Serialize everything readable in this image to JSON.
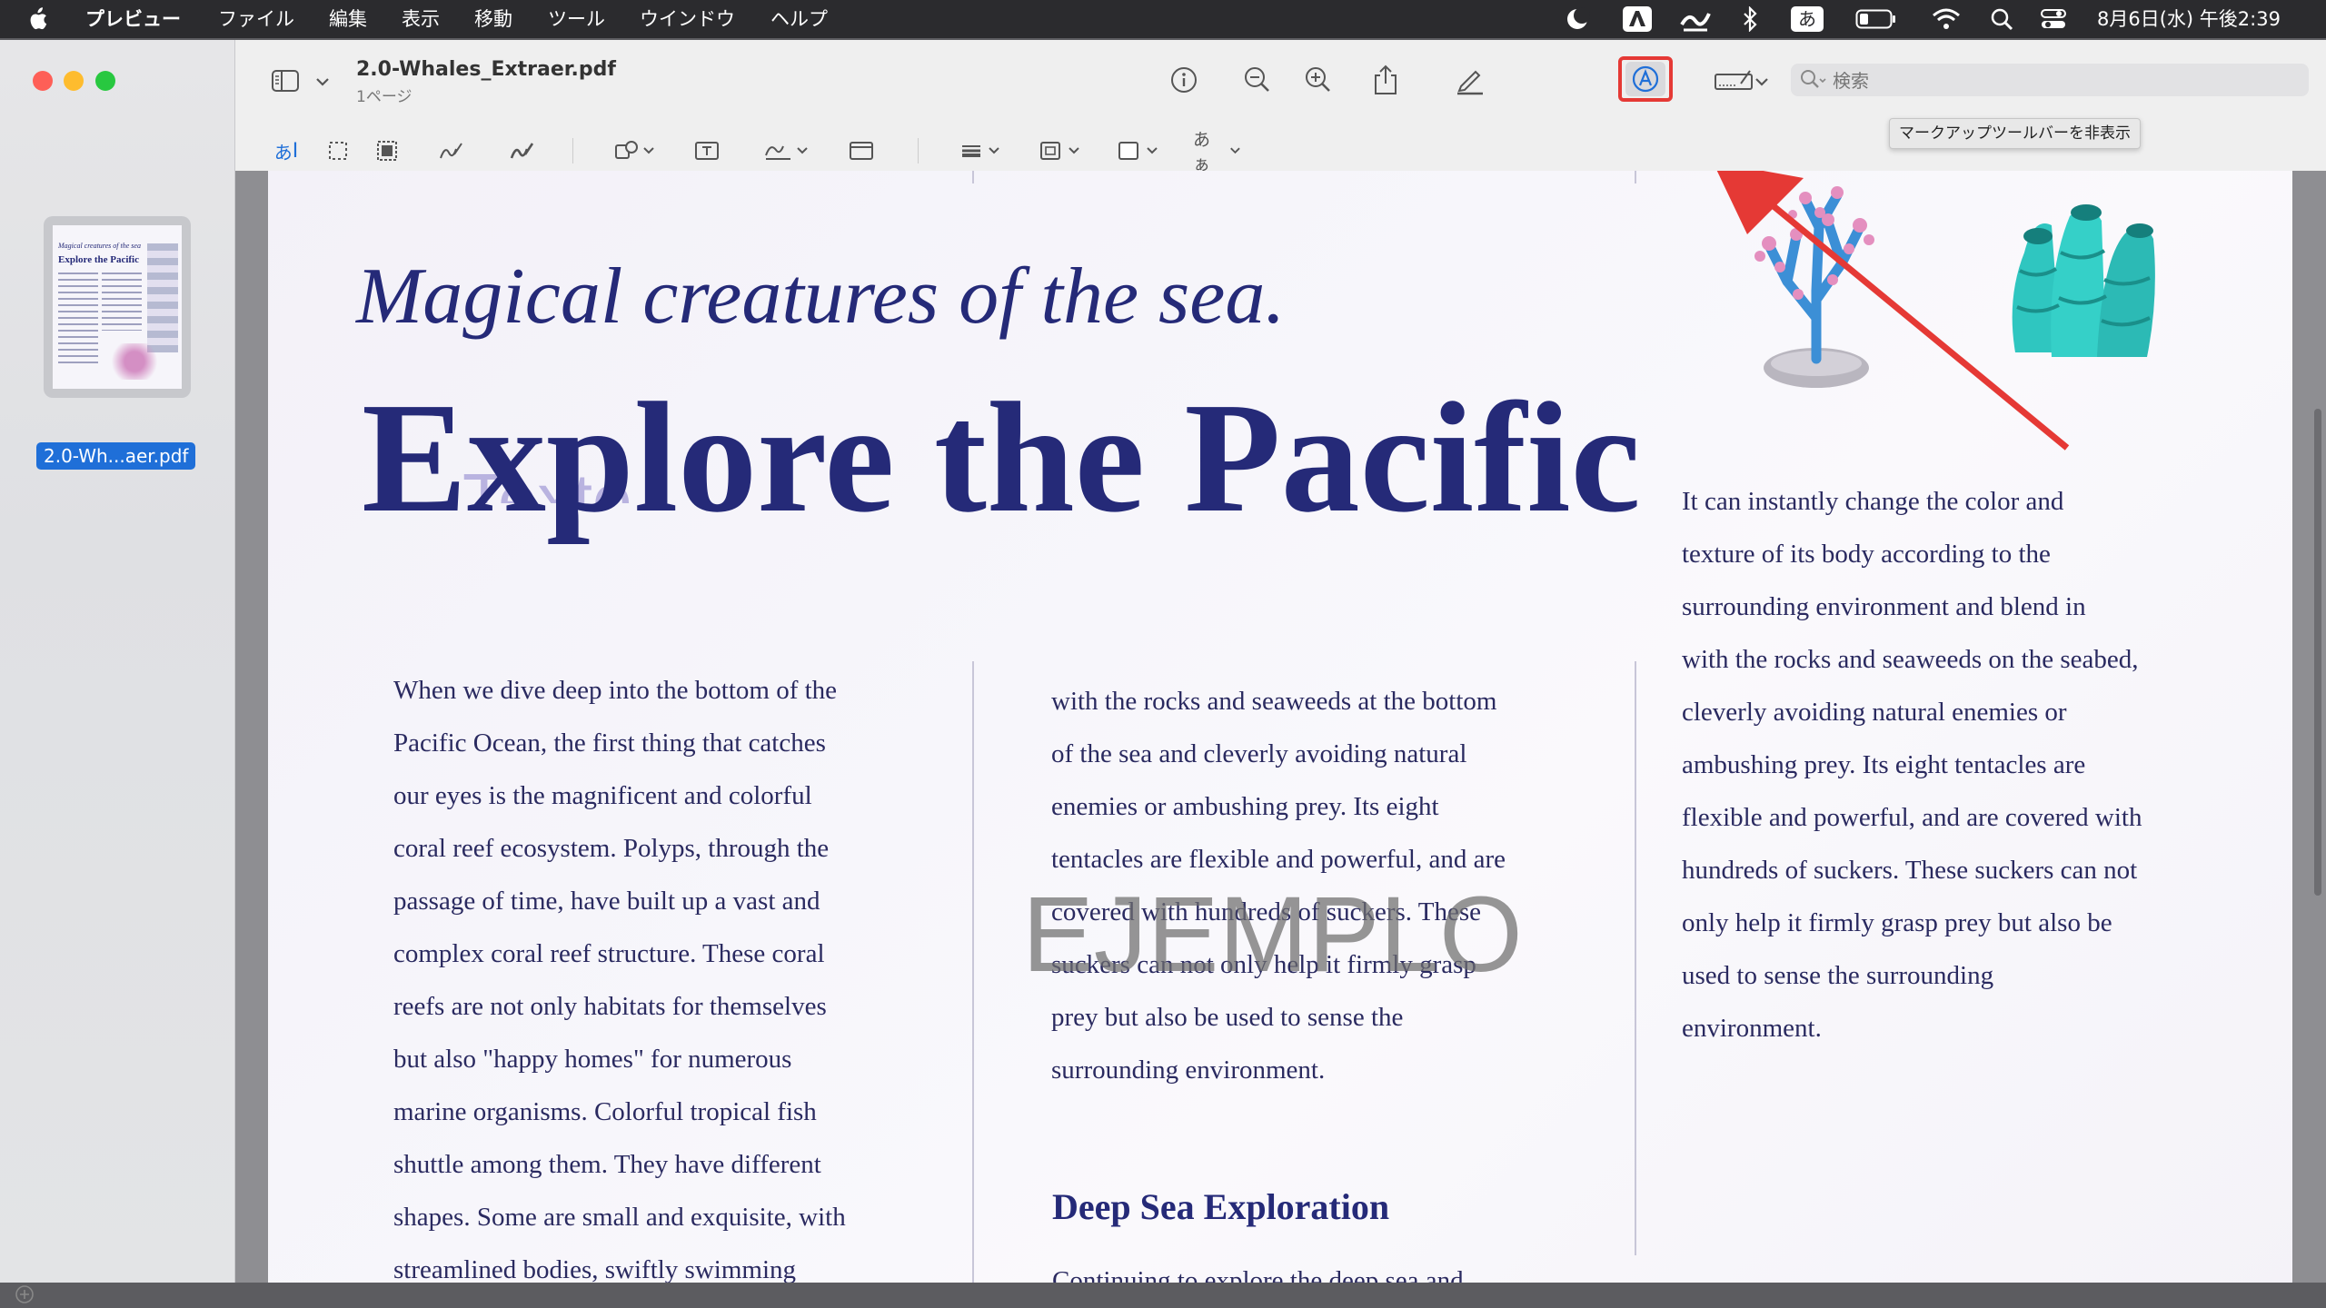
{
  "menubar": {
    "items": [
      "プレビュー",
      "ファイル",
      "編集",
      "表示",
      "移動",
      "ツール",
      "ウインドウ",
      "ヘルプ"
    ],
    "input_source": "あ",
    "datetime": "8月6日(水) 午後2:39"
  },
  "window": {
    "filename": "2.0-Whales_Extraer.pdf",
    "pages": "1ページ",
    "search_placeholder": "検索",
    "tooltip": "マークアップツールバーを非表示"
  },
  "sidebar": {
    "thumbnail_label": "2.0-Wh...aer.pdf",
    "thumb_title_small": "Magical creatures of the sea",
    "thumb_title": "Explore the Pacific"
  },
  "markup": {
    "text_tool": "あ",
    "font_tool": "あぁ"
  },
  "document": {
    "subtitle": "Magical creatures of the sea.",
    "title": "Explore the Pacific",
    "ghost_label": "Texto",
    "watermark": "EJEMPLO",
    "col1_lines": [
      "When we dive deep into the bottom of the",
      "Pacific Ocean, the first thing that catches",
      "our eyes is the magnificent and colorful",
      "coral reef ecosystem. Polyps, through the",
      "passage of time, have built up a vast and",
      "complex coral reef structure. These coral",
      "reefs are not only habitats for themselves",
      "but also \"happy homes\" for numerous",
      "marine organisms. Colorful tropical fish",
      "shuttle among them. They have different",
      "shapes. Some are small and exquisite, with",
      "streamlined bodies, swiftly swimming"
    ],
    "col2_lines": [
      "with the rocks and seaweeds at the bottom",
      "of the sea and cleverly avoiding natural",
      "enemies or ambushing prey. Its eight",
      "tentacles are flexible and powerful, and are",
      "covered with hundreds of suckers. These",
      "suckers can not only help it firmly grasp",
      "prey but also be used to sense the",
      "surrounding environment."
    ],
    "col3_lines": [
      "It can instantly change the color and",
      "texture of its body according to the",
      "surrounding environment and blend in",
      "with the rocks and seaweeds on the seabed,",
      "cleverly avoiding natural enemies or",
      "ambushing prey. Its eight tentacles are",
      "flexible and powerful, and are covered with",
      "hundreds of suckers. These suckers can not",
      "only help it firmly grasp prey but also be",
      "used to sense the surrounding",
      "environment."
    ],
    "section_heading": "Deep Sea Exploration",
    "section_partial": "Continuing to explore the deep sea and"
  },
  "colors": {
    "title_navy": "#252a78",
    "body_text": "#2a2a60",
    "highlight_red": "#e53935",
    "selection_blue": "#1f6fd8"
  }
}
